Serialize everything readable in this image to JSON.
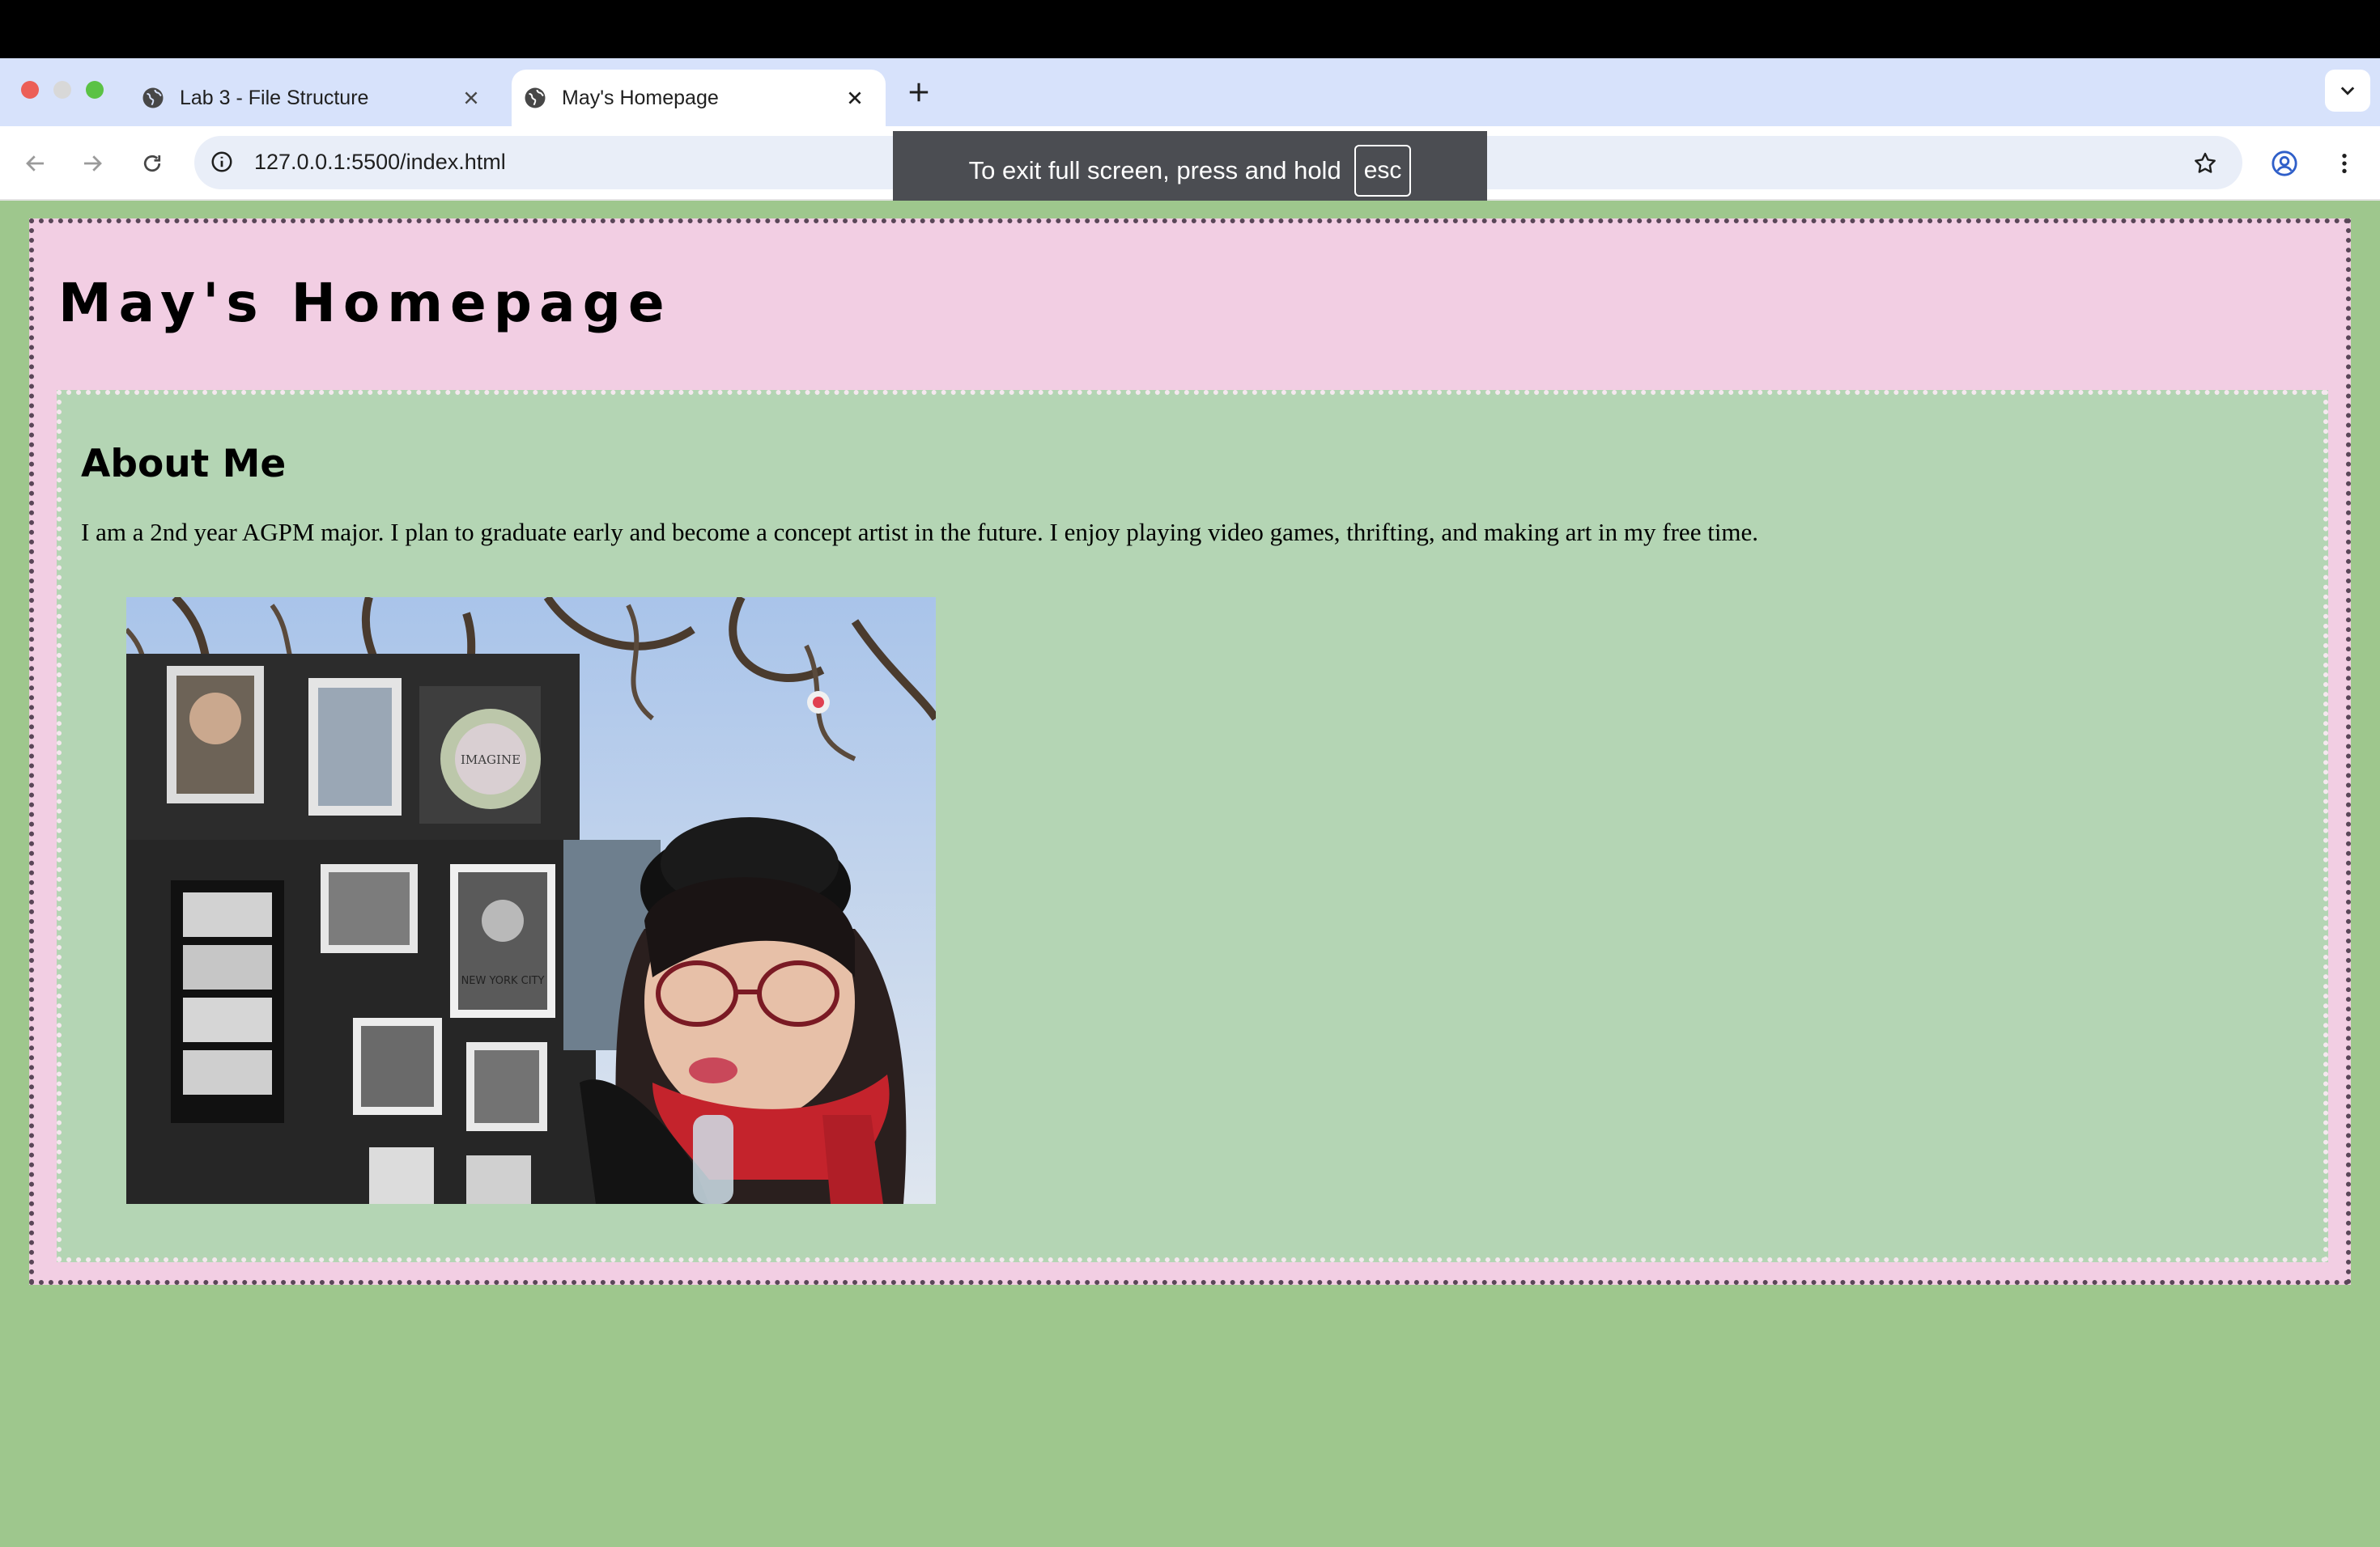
{
  "browser": {
    "tabs": [
      {
        "title": "Lab 3 - File Structure",
        "active": false
      },
      {
        "title": "May's Homepage",
        "active": true
      }
    ],
    "url": "127.0.0.1:5500/index.html",
    "fullscreen_notice": {
      "text": "To exit full screen, press and hold",
      "key": "esc"
    }
  },
  "page": {
    "title": "May's Homepage",
    "about_heading": "About Me",
    "bio": "I am a 2nd year AGPM major. I plan to graduate early and become a concept artist in the future. I enjoy playing video games, thrifting, and making art in my free time.",
    "photo_poster_labels": [
      "IMAGINE",
      "NEW YORK CITY"
    ]
  },
  "colors": {
    "page_bg": "#9ec78d",
    "outer_box_bg": "#f2cee3",
    "inner_box_bg": "#b4d5b4",
    "outer_border": "#5a4658",
    "inner_border": "#f5e8ef",
    "tabstrip_bg": "#d7e2fb"
  },
  "icons": [
    "globe-icon",
    "close-icon",
    "plus-icon",
    "chevron-down-icon",
    "back-arrow-icon",
    "forward-arrow-icon",
    "reload-icon",
    "info-icon",
    "star-icon",
    "profile-icon",
    "kebab-menu-icon"
  ]
}
